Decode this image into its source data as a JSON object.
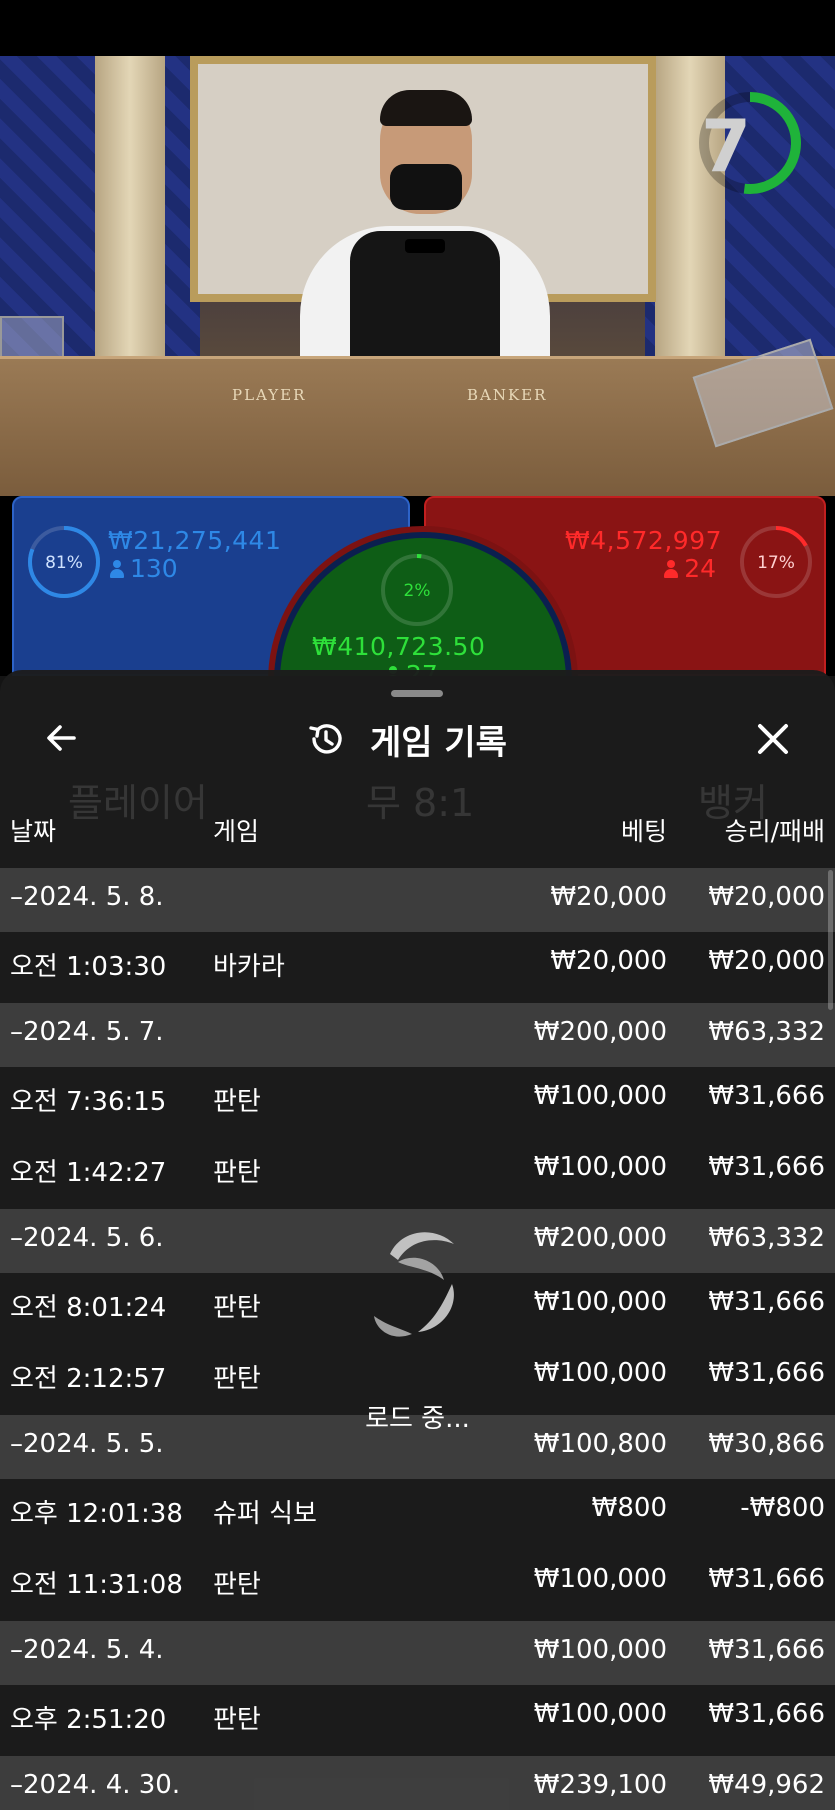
{
  "stream": {
    "countdown": "7",
    "table_labels": {
      "player": "PLAYER",
      "banker": "BANKER"
    }
  },
  "bets": {
    "player": {
      "percent": "81%",
      "amount": "₩21,275,441",
      "count": "130",
      "fill": 0.81,
      "color": "#2e88e6"
    },
    "tie": {
      "percent": "2%",
      "amount": "₩410,723.50",
      "count": "27",
      "fill": 0.02,
      "color": "#2ee03a"
    },
    "banker": {
      "percent": "17%",
      "amount": "₩4,572,997",
      "count": "24",
      "fill": 0.17,
      "color": "#ff2a2a"
    }
  },
  "background_text": {
    "player": "플레이어",
    "tie": "무 8:1",
    "banker": "뱅커"
  },
  "sheet": {
    "title": "게임 기록",
    "columns": {
      "date": "날짜",
      "game": "게임",
      "bet": "베팅",
      "result": "승리/패배"
    },
    "rows": [
      {
        "type": "day",
        "date": "–2024. 5. 8.",
        "game": "",
        "bet": "₩20,000",
        "result": "₩20,000"
      },
      {
        "type": "game",
        "date": "오전 1:03:30",
        "game": "바카라",
        "bet": "₩20,000",
        "result": "₩20,000"
      },
      {
        "type": "day",
        "date": "–2024. 5. 7.",
        "game": "",
        "bet": "₩200,000",
        "result": "₩63,332"
      },
      {
        "type": "game",
        "date": "오전 7:36:15",
        "game": "판탄",
        "bet": "₩100,000",
        "result": "₩31,666"
      },
      {
        "type": "game",
        "date": "오전 1:42:27",
        "game": "판탄",
        "bet": "₩100,000",
        "result": "₩31,666"
      },
      {
        "type": "day",
        "date": "–2024. 5. 6.",
        "game": "",
        "bet": "₩200,000",
        "result": "₩63,332"
      },
      {
        "type": "game",
        "date": "오전 8:01:24",
        "game": "판탄",
        "bet": "₩100,000",
        "result": "₩31,666"
      },
      {
        "type": "game",
        "date": "오전 2:12:57",
        "game": "판탄",
        "bet": "₩100,000",
        "result": "₩31,666"
      },
      {
        "type": "day",
        "date": "–2024. 5. 5.",
        "game": "",
        "bet": "₩100,800",
        "result": "₩30,866"
      },
      {
        "type": "game",
        "date": "오후 12:01:38",
        "game": "슈퍼 식보",
        "bet": "₩800",
        "result": "-₩800"
      },
      {
        "type": "game",
        "date": "오전 11:31:08",
        "game": "판탄",
        "bet": "₩100,000",
        "result": "₩31,666"
      },
      {
        "type": "day",
        "date": "–2024. 5. 4.",
        "game": "",
        "bet": "₩100,000",
        "result": "₩31,666"
      },
      {
        "type": "game",
        "date": "오후 2:51:20",
        "game": "판탄",
        "bet": "₩100,000",
        "result": "₩31,666"
      },
      {
        "type": "day",
        "date": "–2024. 4. 30.",
        "game": "",
        "bet": "₩239,100",
        "result": "₩49,962"
      }
    ],
    "loading_text": "로드 중..."
  }
}
